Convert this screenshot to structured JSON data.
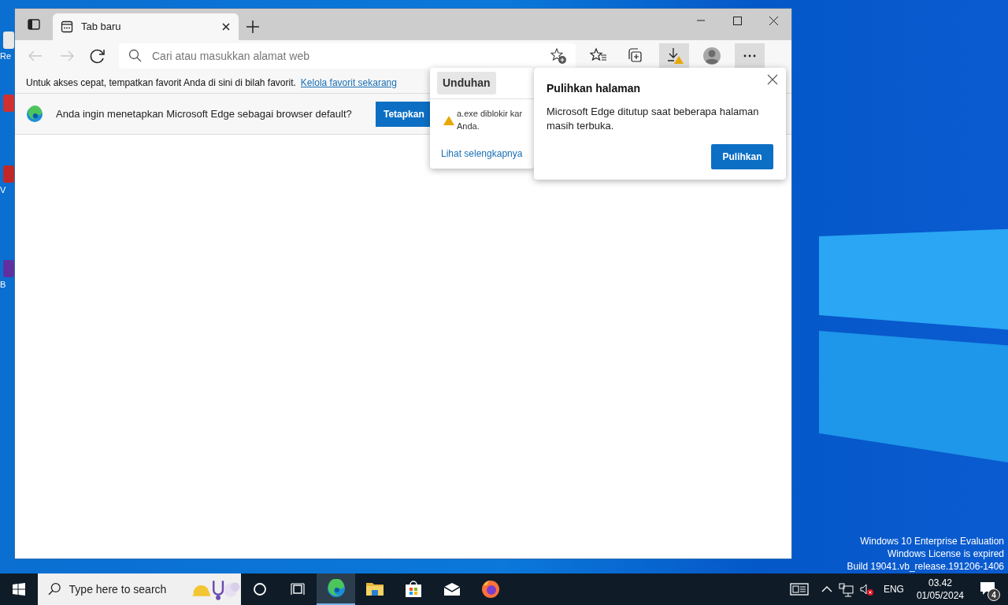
{
  "desktop": {
    "icons": [
      {
        "label": "Re",
        "color": "#e8e8e8"
      },
      {
        "color": "#d03030"
      },
      {
        "label": "V",
        "color": "#c02828"
      },
      {
        "label": "B",
        "color": "#6030a0"
      }
    ],
    "activation": [
      "Windows 10 Enterprise Evaluation",
      "Windows License is expired",
      "Build 19041.vb_release.191206-1406"
    ]
  },
  "browser": {
    "tabs": [
      {
        "title": "Tab baru",
        "selected": true
      }
    ],
    "address": {
      "placeholder": "Cari atau masukkan alamat web"
    },
    "favorites_bar": {
      "message": "Untuk akses cepat, tempatkan favorit Anda di sini di bilah favorit.",
      "link": "Kelola favorit sekarang"
    },
    "infobar": {
      "message": "Anda ingin menetapkan Microsoft Edge sebagai browser default?",
      "button": "Tetapkan"
    },
    "downloads_popup": {
      "title": "Unduhan",
      "item_lines": [
        "a.exe diblokir kar",
        "Anda."
      ],
      "link": "Lihat selengkapnya"
    },
    "restore_popup": {
      "title": "Pulihkan halaman",
      "message": "Microsoft Edge ditutup saat beberapa halaman masih terbuka.",
      "button": "Pulihkan"
    }
  },
  "taskbar": {
    "search_placeholder": "Type here to search",
    "apps": [
      {
        "kind": "edge",
        "selected": true
      },
      {
        "kind": "folder",
        "selected": false
      },
      {
        "kind": "store",
        "selected": false
      },
      {
        "kind": "mail",
        "selected": false
      },
      {
        "kind": "firefox",
        "selected": false
      }
    ],
    "language": "ENG",
    "time": "03.42",
    "date": "01/05/2024",
    "notifications": "4"
  }
}
